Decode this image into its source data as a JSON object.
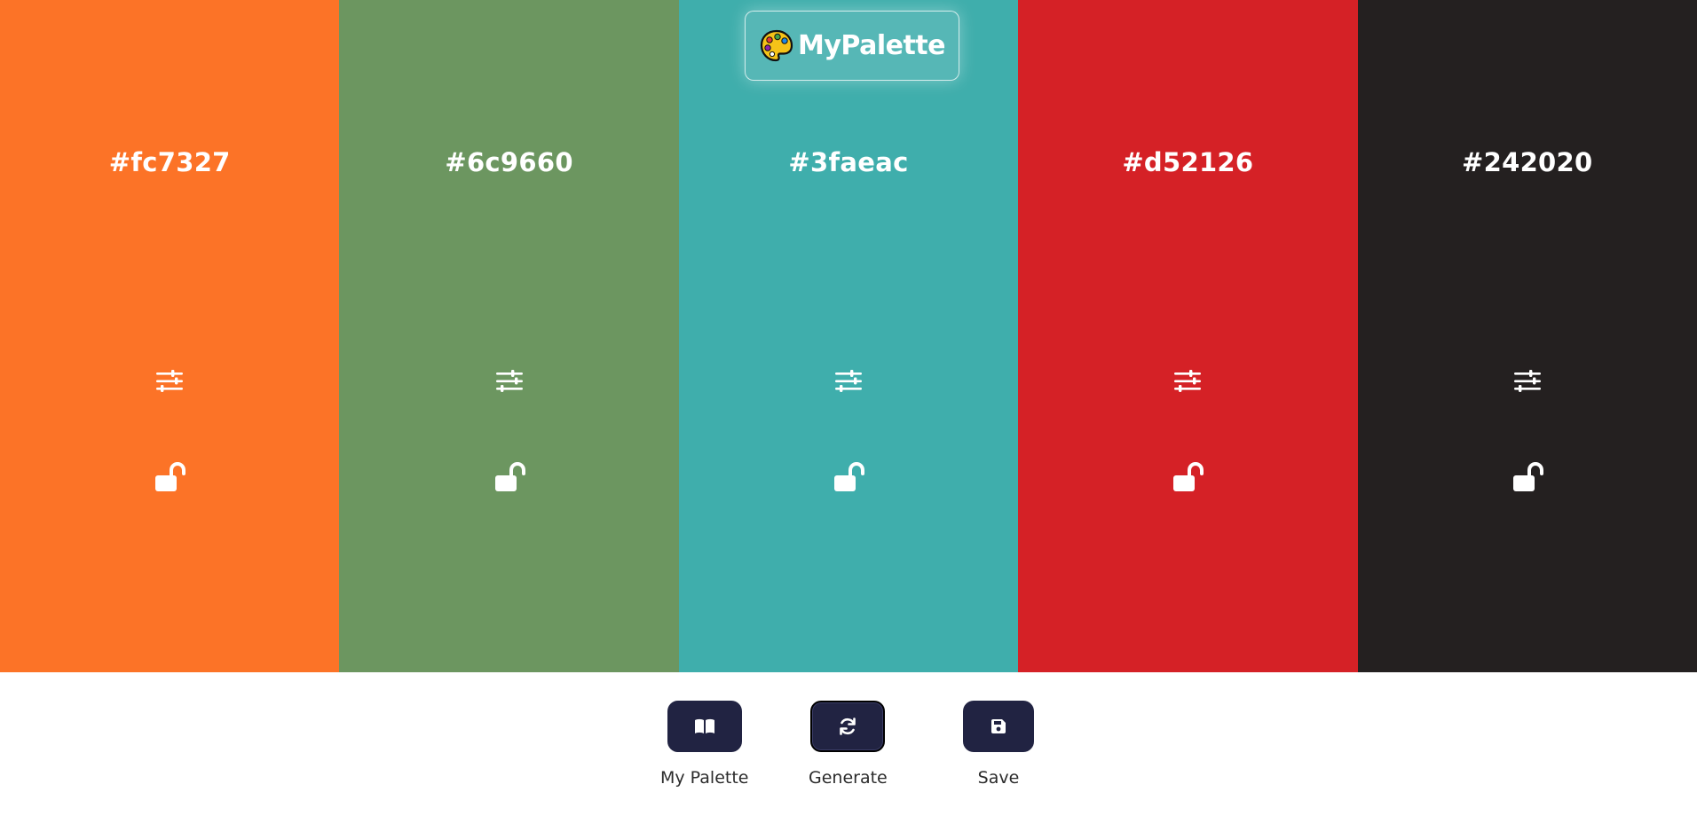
{
  "app": {
    "logo_text": "MyPalette"
  },
  "swatches": [
    {
      "hex": "#fc7327",
      "color": "#fc7327"
    },
    {
      "hex": "#6c9660",
      "color": "#6c9660"
    },
    {
      "hex": "#3faeac",
      "color": "#3faeac"
    },
    {
      "hex": "#d52126",
      "color": "#d52126"
    },
    {
      "hex": "#242020",
      "color": "#242020"
    }
  ],
  "swatch_icons": {
    "adjust": "sliders-icon",
    "lock": "unlocked-lock-icon"
  },
  "toolbar": {
    "my_palette_label": "My Palette",
    "generate_label": "Generate",
    "save_label": "Save",
    "button_color": "#212342"
  }
}
